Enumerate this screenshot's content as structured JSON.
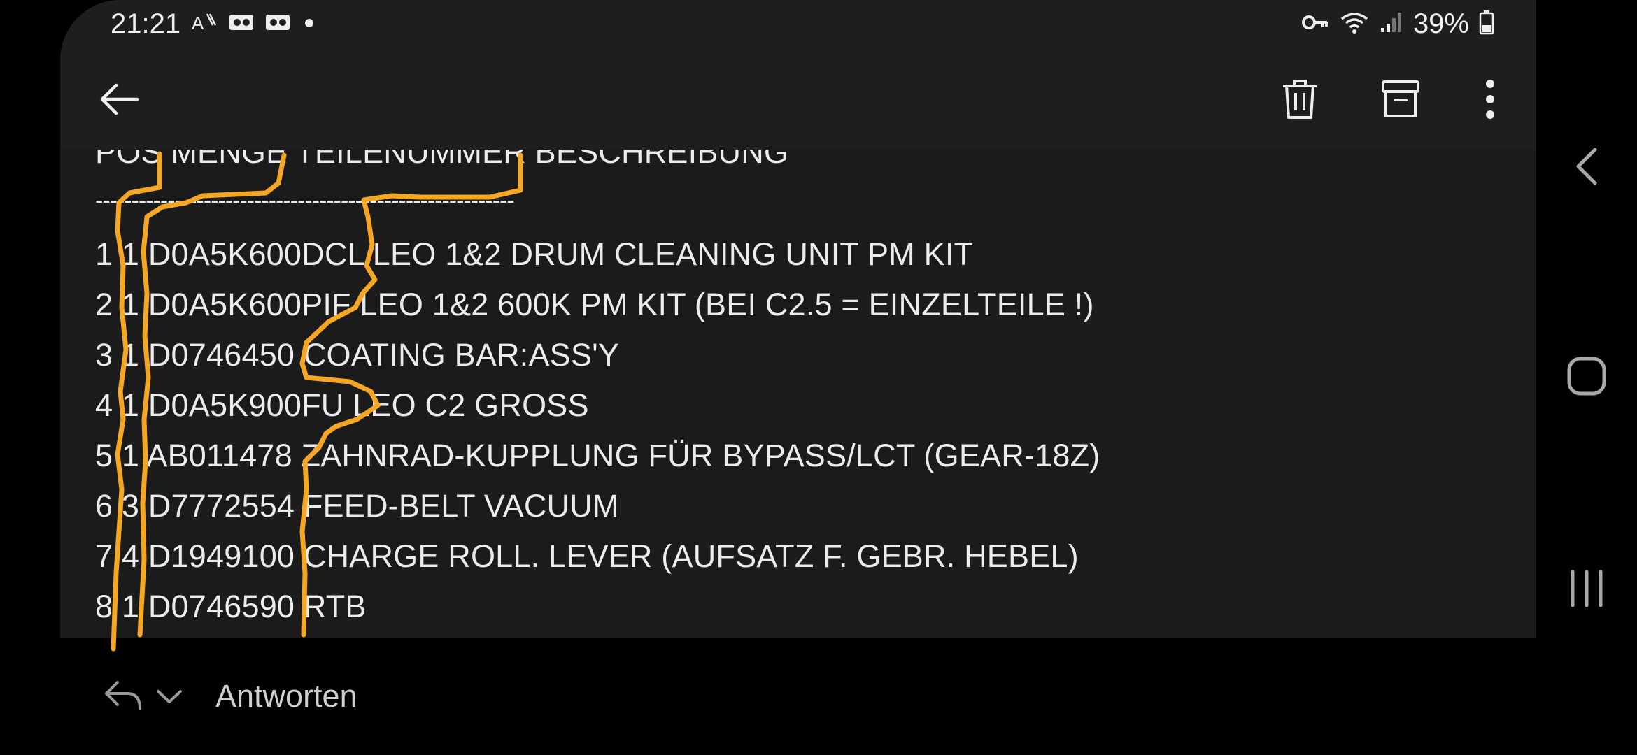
{
  "status_bar": {
    "time": "21:21",
    "battery_percent": "39%",
    "left_icons": [
      "accessibility-text-icon",
      "voicemail-icon",
      "voicemail-icon",
      "dot-icon"
    ],
    "right_icons": [
      "vpn-key-icon",
      "wifi-icon",
      "signal-icon",
      "battery-icon"
    ]
  },
  "app_bar": {
    "back": "back-arrow-icon",
    "actions": [
      "delete-icon",
      "archive-icon",
      "more-vert-icon"
    ]
  },
  "email_body": {
    "lines": [
      "POS MENGE TEILENUMMER BESCHREIBUNG",
      "----------------------------------------------------------",
      "1 1 D0A5K600DCL LEO 1&2 DRUM CLEANING UNIT PM KIT",
      "2 1 D0A5K600PIF LEO 1&2 600K PM KIT (BEI C2.5 = EINZELTEILE !)",
      "3 1 D0746450 COATING BAR:ASS'Y",
      "4 1 D0A5K900FU LEO C2 GROSS",
      "5 1 AB011478 ZAHNRAD-KUPPLUNG FÜR BYPASS/LCT (GEAR-18Z)",
      "6 3 D7772554 FEED-BELT VACUUM",
      "7 4 D1949100 CHARGE ROLL. LEVER (AUFSATZ F. GEBR. HEBEL)",
      "8 1 D0746590 RTB"
    ]
  },
  "reply_bar": {
    "label": "Antworten"
  },
  "navigation": {
    "buttons": [
      "nav-back-icon",
      "nav-home-icon",
      "nav-recents-icon"
    ]
  },
  "colors": {
    "background": "#000000",
    "surface": "#1b1b1b",
    "text": "#ececec",
    "annotation": "#f5a623"
  }
}
